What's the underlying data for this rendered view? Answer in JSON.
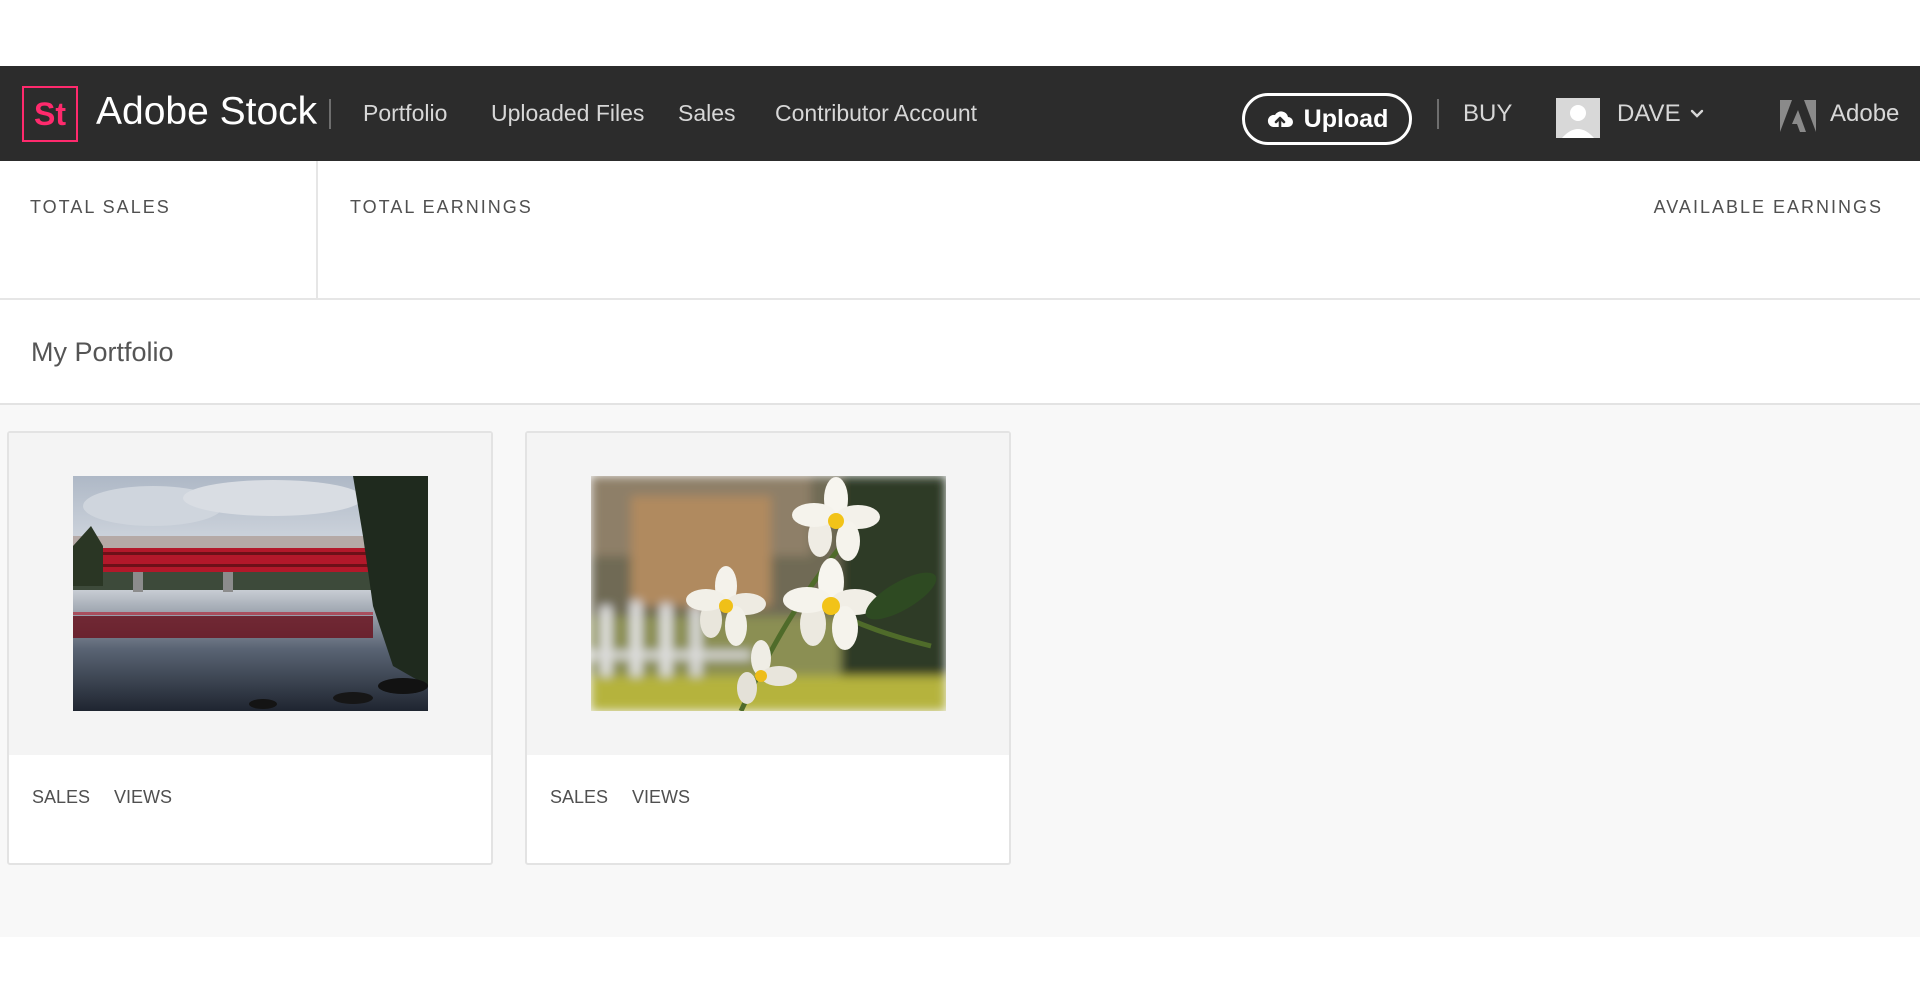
{
  "header": {
    "logo_text": "St",
    "brand": "Adobe Stock",
    "nav": [
      "Portfolio",
      "Uploaded Files",
      "Sales",
      "Contributor Account"
    ],
    "upload_label": "Upload",
    "buy_label": "BUY",
    "user_name": "DAVE",
    "adobe_label": "Adobe"
  },
  "stats": {
    "total_sales_label": "TOTAL SALES",
    "total_sales_value": "",
    "total_earnings_label": "TOTAL EARNINGS",
    "total_earnings_value": "",
    "available_earnings_label": "AVAILABLE EARNINGS",
    "available_earnings_value": ""
  },
  "portfolio": {
    "title": "My Portfolio",
    "items": [
      {
        "subject": "red-covered-bridge-reflection",
        "sales_label": "SALES",
        "views_label": "VIEWS"
      },
      {
        "subject": "white-frangipani-flowers",
        "sales_label": "SALES",
        "views_label": "VIEWS"
      }
    ]
  },
  "colors": {
    "navbar_bg": "#2c2c2c",
    "brand_accent": "#ff2a6d",
    "page_bg": "#f8f8f8"
  },
  "icons": [
    "upload-cloud-icon",
    "user-avatar-icon",
    "chevron-down-icon",
    "adobe-logo-icon"
  ]
}
